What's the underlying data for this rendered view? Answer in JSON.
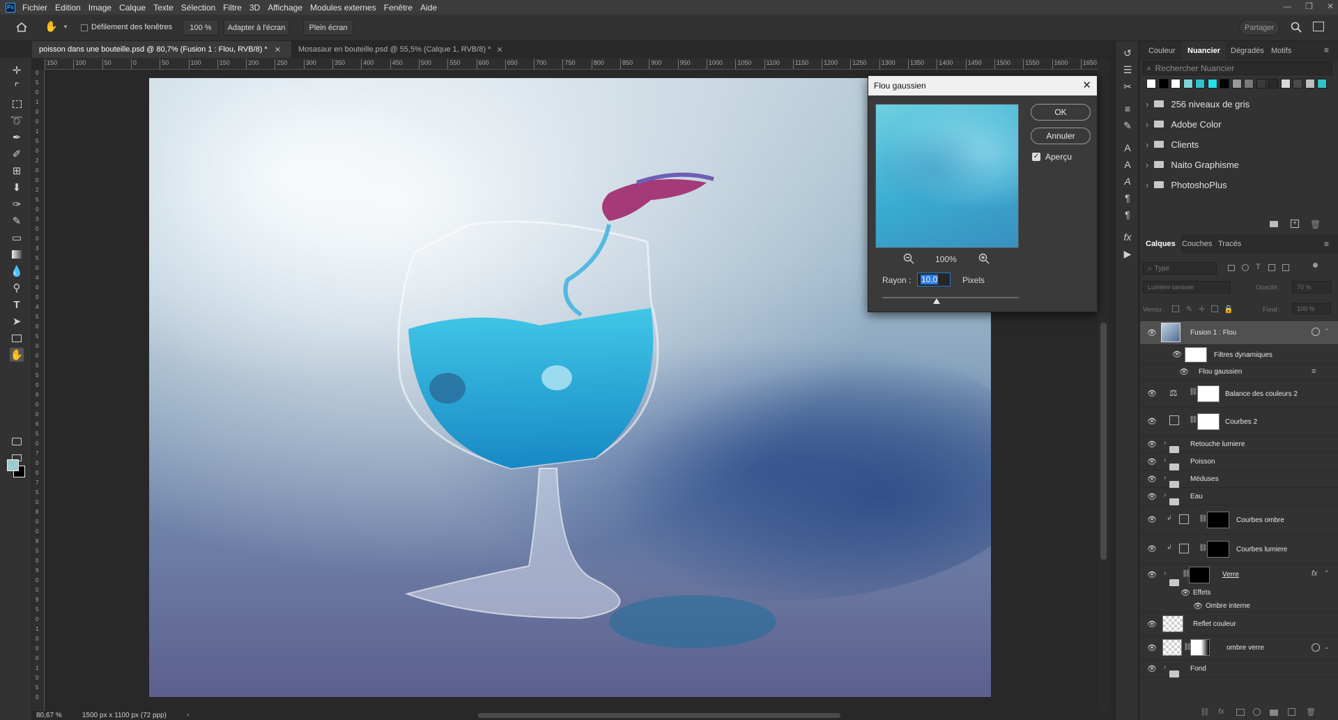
{
  "app": {
    "logo": "Ps"
  },
  "menu": [
    "Fichier",
    "Edition",
    "Image",
    "Calque",
    "Texte",
    "Sélection",
    "Filtre",
    "3D",
    "Affichage",
    "Modules externes",
    "Fenêtre",
    "Aide"
  ],
  "options": {
    "scroll_all_windows": "Défilement des fenêtres",
    "zoom_btn": "100 %",
    "fit_btn": "Adapter à l'écran",
    "fullscreen_btn": "Plein écran",
    "share_btn": "Partager"
  },
  "tabs": [
    {
      "label": "poisson dans une bouteille.psd @ 80,7% (Fusion 1 : Flou, RVB/8) *",
      "active": true
    },
    {
      "label": "Mosasaur en bouteille.psd @ 55,5% (Calque 1, RVB/8) *",
      "active": false
    }
  ],
  "ruler_labels": [
    "150",
    "100",
    "50",
    "0",
    "50",
    "100",
    "150",
    "200",
    "250",
    "300",
    "350",
    "400",
    "450",
    "500",
    "550",
    "600",
    "650",
    "700",
    "750",
    "800",
    "850",
    "900",
    "950",
    "1000",
    "1050",
    "1100",
    "1150",
    "1200",
    "1250",
    "1300",
    "1350",
    "1400",
    "1450",
    "1500",
    "1550",
    "1600",
    "1650"
  ],
  "vruler_labels": [
    "0",
    "5",
    "0",
    "1",
    "0",
    "0",
    "1",
    "5",
    "0",
    "2",
    "0",
    "0",
    "2",
    "5",
    "0",
    "3",
    "0",
    "0",
    "3",
    "5",
    "0",
    "4",
    "0",
    "0",
    "4",
    "5",
    "0",
    "5",
    "0",
    "0",
    "5",
    "5",
    "0",
    "6",
    "0",
    "0",
    "6",
    "5",
    "0",
    "7",
    "0",
    "0",
    "7",
    "5",
    "0",
    "8",
    "0",
    "0",
    "8",
    "5",
    "0",
    "9",
    "0",
    "0",
    "9",
    "5",
    "0",
    "1",
    "0",
    "0",
    "0",
    "1",
    "0",
    "5",
    "0"
  ],
  "status": {
    "zoom": "80,67 %",
    "doc_size": "1500 px x 1100 px (72 ppp)"
  },
  "dialog": {
    "title": "Flou gaussien",
    "ok": "OK",
    "cancel": "Annuler",
    "preview_label": "Aperçu",
    "preview_checked": true,
    "zoom_level": "100%",
    "radius_label": "Rayon :",
    "radius_value": "10,0",
    "radius_unit": "Pixels",
    "slider_fraction": 0.4
  },
  "swatches_panel": {
    "tabs": [
      "Couleur",
      "Nuancier",
      "Dégradés",
      "Motifs"
    ],
    "active_tab": "Nuancier",
    "search_placeholder": "Rechercher Nuancier",
    "swatch_colors": [
      "#ffffff",
      "#000000",
      "#ffffff",
      "#7fd3d8",
      "#2fc3cd",
      "#23e0e6",
      "#000000",
      "#9a9a9a",
      "#7a7a7a",
      "#3a3a3a",
      "#2a2a2a",
      "#d8d8d8",
      "#4a4a4a",
      "#bfbfbf",
      "#33c1c6"
    ],
    "folders": [
      "256 niveaux de gris",
      "Adobe Color",
      "Clients",
      "Naito Graphisme",
      "PhotoshoPlus"
    ]
  },
  "layers_panel": {
    "tabs": [
      "Calques",
      "Couches",
      "Tracés"
    ],
    "active_tab": "Calques",
    "filter_placeholder": "Type",
    "blend_mode": "Lumière tamisée",
    "opacity_label": "Opacité :",
    "opacity_value": "70 %",
    "lock_label": "Verrou :",
    "fill_label": "Fond :",
    "fill_value": "100 %",
    "layers": [
      {
        "name": "Fusion 1 : Flou",
        "kind": "smart",
        "selected": true
      },
      {
        "name": "Filtres dynamiques",
        "kind": "sub-mask"
      },
      {
        "name": "Flou gaussien",
        "kind": "sub-filter"
      },
      {
        "name": "Balance des couleurs 2",
        "kind": "adjust"
      },
      {
        "name": "Courbes 2",
        "kind": "adjust"
      },
      {
        "name": "Retouche lumiere",
        "kind": "group"
      },
      {
        "name": "Poisson",
        "kind": "group"
      },
      {
        "name": "Méduses",
        "kind": "group"
      },
      {
        "name": "Eau",
        "kind": "group"
      },
      {
        "name": "Courbes ombre",
        "kind": "clip-adjust"
      },
      {
        "name": "Courbes lumiere",
        "kind": "clip-adjust"
      },
      {
        "name": "Verre",
        "kind": "group-mask"
      },
      {
        "name": "Effets",
        "kind": "sub-effects"
      },
      {
        "name": "Ombre interne",
        "kind": "sub-effect"
      },
      {
        "name": "Reflet couleur",
        "kind": "pixel"
      },
      {
        "name": "ombre verre",
        "kind": "smart-mask"
      },
      {
        "name": "Fond",
        "kind": "group"
      }
    ]
  }
}
